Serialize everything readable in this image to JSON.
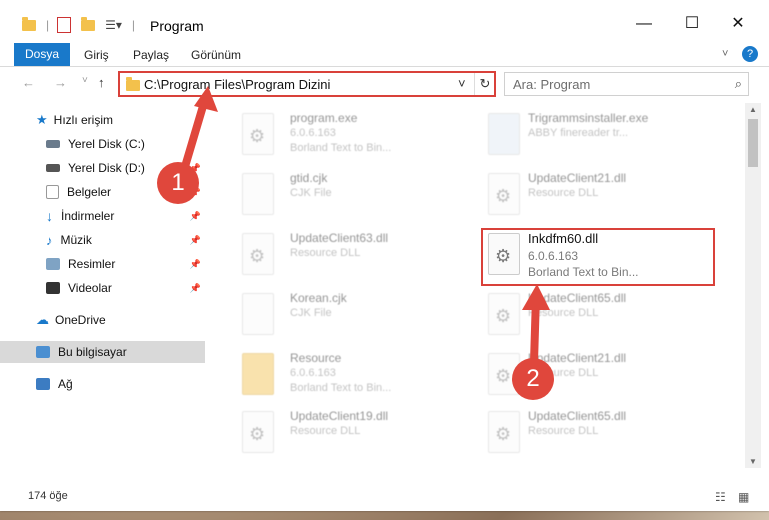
{
  "window": {
    "title": "Program",
    "minimize": "—",
    "maximize": "☐",
    "close": "✕"
  },
  "ribbon": {
    "file_tab": "Dosya",
    "tabs": [
      "Giriş",
      "Paylaş",
      "Görünüm"
    ],
    "help": "?"
  },
  "address": {
    "path": "C:\\Program Files\\Program Dizini",
    "search_placeholder": "Ara: Program"
  },
  "sidebar": {
    "items": [
      {
        "label": "Hızlı erişim",
        "icon": "star-icon"
      },
      {
        "label": "Yerel Disk (C:)",
        "icon": "drive-icon",
        "pinned": true
      },
      {
        "label": "Yerel Disk (D:)",
        "icon": "drive-icon",
        "pinned": true
      },
      {
        "label": "Belgeler",
        "icon": "documents-icon",
        "pinned": true
      },
      {
        "label": "İndirmeler",
        "icon": "download-icon",
        "pinned": true
      },
      {
        "label": "Müzik",
        "icon": "music-icon",
        "pinned": true
      },
      {
        "label": "Resimler",
        "icon": "pictures-icon",
        "pinned": true
      },
      {
        "label": "Videolar",
        "icon": "video-icon",
        "pinned": true
      },
      {
        "label": "OneDrive",
        "icon": "cloud-icon"
      },
      {
        "label": "Bu bilgisayar",
        "icon": "computer-icon",
        "selected": true
      },
      {
        "label": "Ağ",
        "icon": "network-icon"
      }
    ]
  },
  "files": [
    {
      "name": "program.exe",
      "line2": "6.0.6.163",
      "line3": "Borland Text to Bin...",
      "faded": true
    },
    {
      "name": "Trigrammsinstaller.exe",
      "line2": "ABBY finereader tr...",
      "line3": "",
      "faded": true
    },
    {
      "name": "gtid.cjk",
      "line2": "CJK File",
      "line3": "",
      "faded": true
    },
    {
      "name": "UpdateClient21.dll",
      "line2": "Resource DLL",
      "line3": "",
      "faded": true
    },
    {
      "name": "UpdateClient63.dll",
      "line2": "Resource DLL",
      "line3": "",
      "faded": true
    },
    {
      "name": "Inkdfm60.dll",
      "line2": "6.0.6.163",
      "line3": "Borland Text to Bin...",
      "faded": false
    },
    {
      "name": "Korean.cjk",
      "line2": "CJK File",
      "line3": "",
      "faded": true
    },
    {
      "name": "UpdateClient65.dll",
      "line2": "Resource DLL",
      "line3": "",
      "faded": true
    },
    {
      "name": "Resource",
      "line2": "6.0.6.163",
      "line3": "Borland Text to Bin...",
      "faded": true
    },
    {
      "name": "UpdateClient21.dll",
      "line2": "Resource DLL",
      "line3": "",
      "faded": true
    },
    {
      "name": "UpdateClient19.dll",
      "line2": "Resource DLL",
      "line3": "",
      "faded": true
    },
    {
      "name": "UpdateClient65.dll",
      "line2": "Resource DLL",
      "line3": "",
      "faded": true
    }
  ],
  "status": {
    "count": "174 öğe"
  },
  "annotations": {
    "badge1": "1",
    "badge2": "2",
    "accent": "#e0473c"
  }
}
